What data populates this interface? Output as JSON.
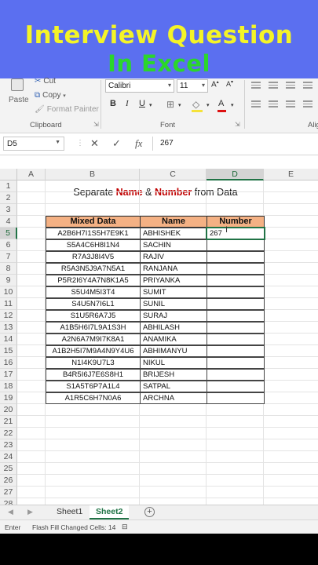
{
  "banner": {
    "line1": "Interview Question",
    "line2": "In Excel"
  },
  "ribbon": {
    "paste_label": "Paste",
    "cut_label": "Cut",
    "copy_label": "Copy",
    "format_painter_label": "Format Painter",
    "clipboard_group": "Clipboard",
    "font_group": "Font",
    "alignment_group": "Alig",
    "font_name": "Calibri",
    "font_size": "11",
    "bold": "B",
    "italic": "I",
    "underline": "U",
    "font_color_letter": "A"
  },
  "formula_bar": {
    "name_box": "D5",
    "cancel": "✕",
    "enter": "✓",
    "fx": "fx",
    "value": "267"
  },
  "columns": [
    "A",
    "B",
    "C",
    "D",
    "E"
  ],
  "rows": [
    "1",
    "2",
    "3",
    "4",
    "5",
    "6",
    "7",
    "8",
    "9",
    "10",
    "11",
    "12",
    "13",
    "14",
    "15",
    "16",
    "17",
    "18",
    "19",
    "20",
    "21",
    "22",
    "23",
    "24",
    "25",
    "26",
    "27",
    "28"
  ],
  "title": {
    "part1": "Separate ",
    "name": "Name",
    "amp": " & ",
    "number": "Number",
    "part2": " from Data"
  },
  "table": {
    "headers": [
      "Mixed Data",
      "Name",
      "Number"
    ],
    "rows": [
      [
        "A2B6H7I1S5H7E9K1",
        "ABHISHEK",
        "267"
      ],
      [
        "S5A4C6H8I1N4",
        "SACHIN",
        ""
      ],
      [
        "R7A3J8I4V5",
        "RAJIV",
        ""
      ],
      [
        "R5A3N5J9A7N5A1",
        "RANJANA",
        ""
      ],
      [
        "P5R2I6Y4A7N8K1A5",
        "PRIYANKA",
        ""
      ],
      [
        "S5U4M5I3T4",
        "SUMIT",
        ""
      ],
      [
        "S4U5N7I6L1",
        "SUNIL",
        ""
      ],
      [
        "S1U5R6A7J5",
        "SURAJ",
        ""
      ],
      [
        "A1B5H6I7L9A1S3H",
        "ABHILASH",
        ""
      ],
      [
        "A2N6A7M9I7K8A1",
        "ANAMIKA",
        ""
      ],
      [
        "A1B2H5I7M9A4N9Y4U6",
        "ABHIMANYU",
        ""
      ],
      [
        "N1I4K9U7L3",
        "NIKUL",
        ""
      ],
      [
        "B4R5I6J7E6S8H1",
        "BRIJESH",
        ""
      ],
      [
        "S1A5T6P7A1L4",
        "SATPAL",
        ""
      ],
      [
        "A1R5C6H7N0A6",
        "ARCHNA",
        ""
      ]
    ]
  },
  "sheets": {
    "tab1": "Sheet1",
    "tab2": "Sheet2",
    "add": "+"
  },
  "status": {
    "mode": "Enter",
    "message": "Flash Fill Changed Cells: 14"
  },
  "colors": {
    "banner_bg": "#5b6ff0",
    "banner_line1": "#f4f427",
    "banner_line2": "#2bd62b",
    "header_fill": "#f4b184",
    "accent": "#217346",
    "title_red": "#c00000"
  }
}
